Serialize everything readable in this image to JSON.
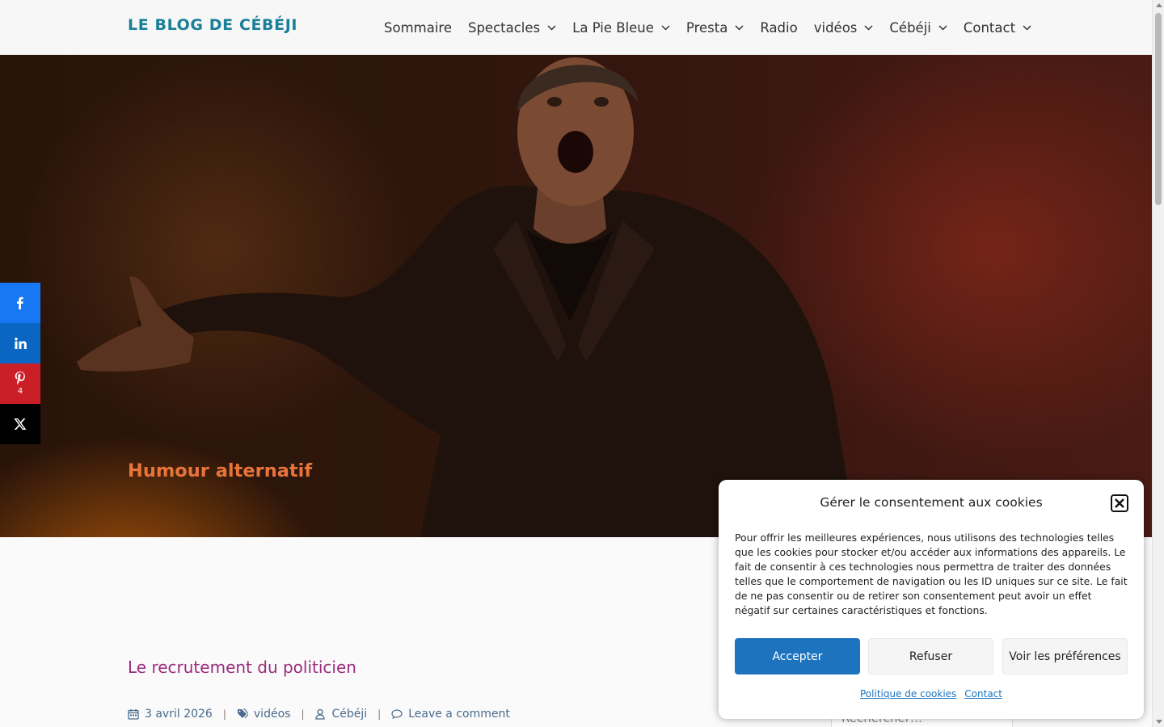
{
  "header": {
    "site_title": "LE BLOG DE CÉBÉJI",
    "nav": [
      {
        "label": "Sommaire",
        "dropdown": false
      },
      {
        "label": "Spectacles",
        "dropdown": true
      },
      {
        "label": "La Pie Bleue",
        "dropdown": true
      },
      {
        "label": "Presta",
        "dropdown": true
      },
      {
        "label": "Radio",
        "dropdown": false
      },
      {
        "label": "vidéos",
        "dropdown": true
      },
      {
        "label": "Cébéji",
        "dropdown": true
      },
      {
        "label": "Contact",
        "dropdown": true
      }
    ]
  },
  "hero": {
    "title": "Humour alternatif"
  },
  "share": {
    "pinterest_count": "4",
    "colors": {
      "facebook": "#1877f2",
      "linkedin": "#0a66c2",
      "pinterest": "#cb1f27",
      "x": "#000000"
    }
  },
  "post": {
    "title": "Le recrutement du politicien",
    "date": "3 avril 2026",
    "category": "vidéos",
    "author": "Cébéji",
    "comments": "Leave a comment"
  },
  "sidebar": {
    "search_placeholder": "Rechercher…"
  },
  "cookie": {
    "title": "Gérer le consentement aux cookies",
    "text": "Pour offrir les meilleures expériences, nous utilisons des technologies telles que les cookies pour stocker et/ou accéder aux informations des appareils. Le fait de consentir à ces technologies nous permettra de traiter des données telles que le comportement de navigation ou les ID uniques sur ce site. Le fait de ne pas consentir ou de retirer son consentement peut avoir un effet négatif sur certaines caractéristiques et fonctions.",
    "accept": "Accepter",
    "refuse": "Refuser",
    "preferences": "Voir les préférences",
    "links": [
      "Politique de cookies",
      "Contact"
    ]
  },
  "colors": {
    "accent": "#1a7f98",
    "hero_title": "#e8743a",
    "post_title": "#9a2c7d",
    "button_primary": "#1e73be"
  }
}
